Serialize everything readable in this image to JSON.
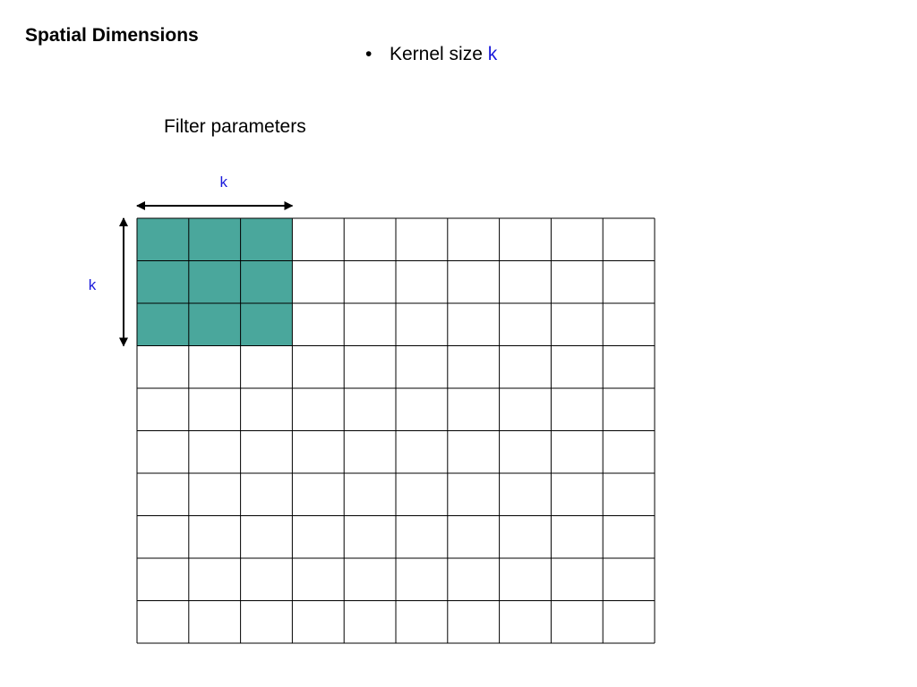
{
  "slide": {
    "title": "Spatial Dimensions"
  },
  "bullets": [
    {
      "text": "Kernel size ",
      "highlight": "k"
    }
  ],
  "subheading": "Filter parameters",
  "diagram": {
    "rows": 10,
    "cols": 10,
    "kernel_size": 3,
    "kernel_color": "#4aa79c",
    "grid_line_color": "#000000",
    "width_label": "k",
    "height_label": "k"
  },
  "colors": {
    "accent": "#1a1adb"
  }
}
